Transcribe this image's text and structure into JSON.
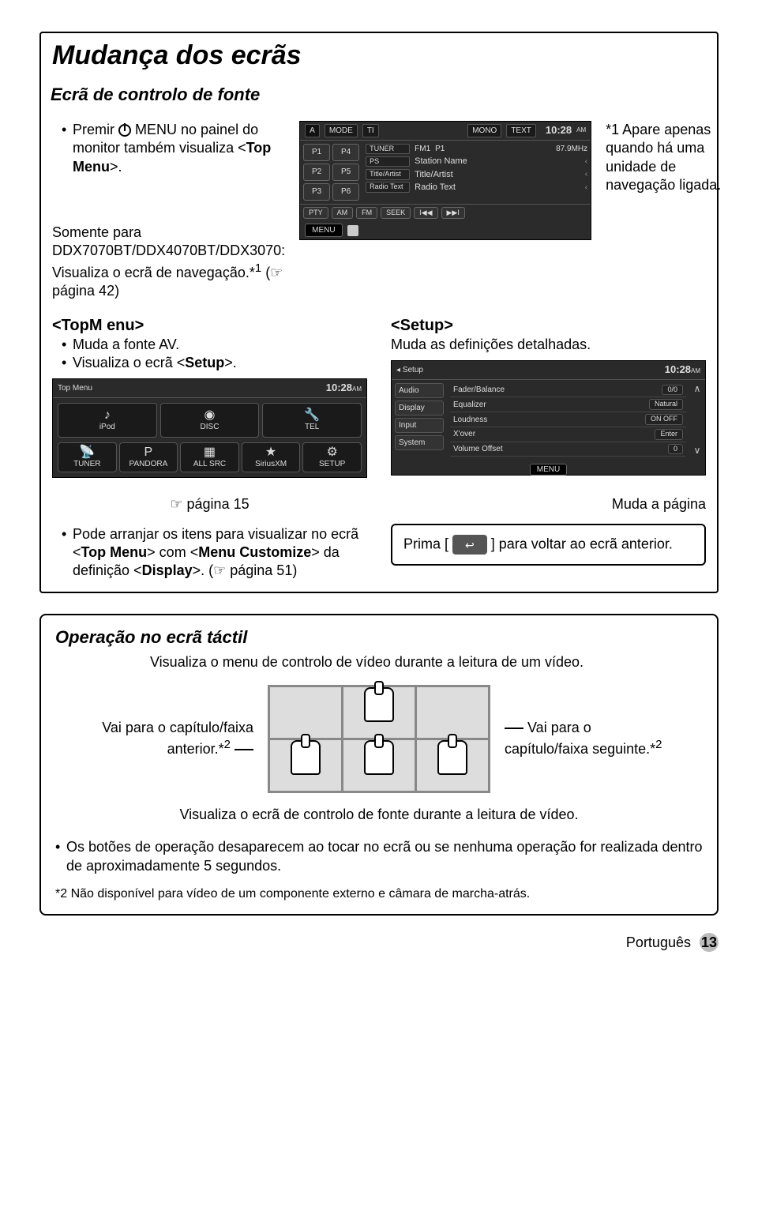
{
  "title": "Mudança dos ecrãs",
  "subtitle": "Ecrã de controlo de fonte",
  "left_instr": {
    "premir_pre": "Premir ",
    "premir_post": " MENU no painel do monitor também visualiza <",
    "topmenu_bold": "Top Menu",
    "premir_end": ">.",
    "somente": "Somente para DDX7070BT/DDX4070BT/DDX3070: Visualiza o ecrã de navegação.*",
    "sup1": "1",
    "nav_ref": " (☞ página 42)"
  },
  "right_note": {
    "star": "*1",
    "text": "Apare apenas quando há uma unidade de navegação ligada."
  },
  "radio": {
    "ant": "A",
    "mode": "MODE",
    "ti": "TI",
    "mono": "MONO",
    "text": "TEXT",
    "clock": "10:28",
    "ampm": "AM",
    "presets": [
      "P1",
      "P4",
      "P2",
      "P5",
      "P3",
      "P6"
    ],
    "tuner_chip": "TUNER",
    "fm1": "FM1",
    "p1": "P1",
    "freq": "87.9MHz",
    "lab_ps": "PS",
    "val_ps": "Station Name",
    "lab_ta": "Title/Artist",
    "val_ta": "Title/Artist",
    "lab_rt": "Radio Text",
    "val_rt": "Radio Text",
    "bot": [
      "PTY",
      "AM",
      "FM",
      "SEEK",
      "I◀◀",
      "▶▶I"
    ],
    "menu": "MENU"
  },
  "topmenu_block": {
    "header": "<TopM enu>",
    "b1": "Muda a fonte AV.",
    "b2_pre": "Visualiza o ecrã <",
    "b2_bold": "Setup",
    "b2_post": ">.",
    "shot_title": "Top Menu",
    "clock": "10:28",
    "ampm": "AM",
    "cells_top": [
      "iPod",
      "DISC",
      "TEL"
    ],
    "cells_bot": [
      "TUNER",
      "PANDORA",
      "ALL SRC",
      "SiriusXM",
      "SETUP"
    ],
    "page_ref": "☞ página 15"
  },
  "setup_block": {
    "header": "<Setup>",
    "desc": "Muda as definições detalhadas.",
    "shot_title": "Setup",
    "clock": "10:28",
    "ampm": "AM",
    "tabs": [
      "Audio",
      "Display",
      "Input",
      "System"
    ],
    "rows": [
      {
        "lab": "Fader/Balance",
        "val": "0/0"
      },
      {
        "lab": "Equalizer",
        "val": "Natural"
      },
      {
        "lab": "Loudness",
        "val": "ON  OFF"
      },
      {
        "lab": "X'over",
        "val": "Enter"
      },
      {
        "lab": "Volume Offset",
        "val": "0"
      }
    ],
    "menu": "MENU",
    "right_ann": "Muda a página"
  },
  "row3_left": {
    "b_pre": "Pode arranjar os itens para visualizar no ecrã <",
    "b_top": "Top Menu",
    "b_mid": "> com <",
    "b_menu": "Menu Customize",
    "b_mid2": "> da definição <",
    "b_disp": "Display",
    "b_end": ">. (☞ página 51)"
  },
  "prima": {
    "pre": "Prima [ ",
    "post": " ] para voltar ao ecrã anterior."
  },
  "touch": {
    "heading": "Operação no ecrã táctil",
    "desc": "Visualiza o menu de controlo de vídeo durante a leitura de um vídeo.",
    "left": "Vai para o capítulo/faixa anterior.*",
    "sup2l": "2",
    "right": "Vai para o capítulo/faixa seguinte.*",
    "sup2r": "2",
    "bottom": "Visualiza o ecrã de controlo de fonte durante a leitura de vídeo."
  },
  "final_bullet": "Os botões de operação desaparecem ao tocar no ecrã ou se nenhuma operação for realizada dentro de aproximadamente 5 segundos.",
  "footnote": "*2 Não disponível para vídeo de um componente externo e câmara de marcha-atrás.",
  "footer_lang": "Português",
  "footer_page": "13"
}
